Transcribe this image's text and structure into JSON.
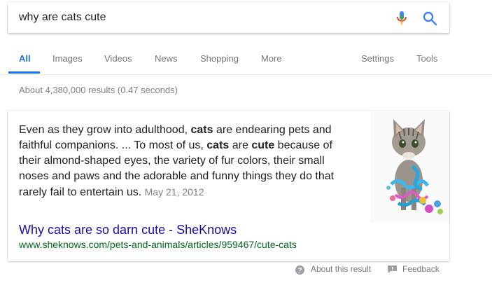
{
  "search": {
    "query": "why are cats cute"
  },
  "tabs": [
    {
      "label": "All"
    },
    {
      "label": "Images"
    },
    {
      "label": "Videos"
    },
    {
      "label": "News"
    },
    {
      "label": "Shopping"
    },
    {
      "label": "More"
    },
    {
      "label": "Settings"
    },
    {
      "label": "Tools"
    }
  ],
  "result_stats": "About 4,380,000 results (0.47 seconds)",
  "snippet": {
    "p1": "Even as they grow into adulthood, ",
    "b1": "cats",
    "p2": " are endearing pets and faithful companions. ... To most of us, ",
    "b2": "cats",
    "p3": " are ",
    "b3": "cute",
    "p4": " because of their almond-shaped eyes, the variety of fur colors, their small noses and paws and the adorable and funny things they do that rarely fail to entertain us.  ",
    "date": "May 21, 2012"
  },
  "result": {
    "title": "Why cats are so darn cute - SheKnows",
    "url": "www.sheknows.com/pets-and-animals/articles/959467/cute-cats"
  },
  "footer": {
    "about": "About this result",
    "feedback": "Feedback"
  },
  "colors": {
    "accent": "#1a73e8",
    "link": "#1a0dab",
    "url": "#006621"
  }
}
